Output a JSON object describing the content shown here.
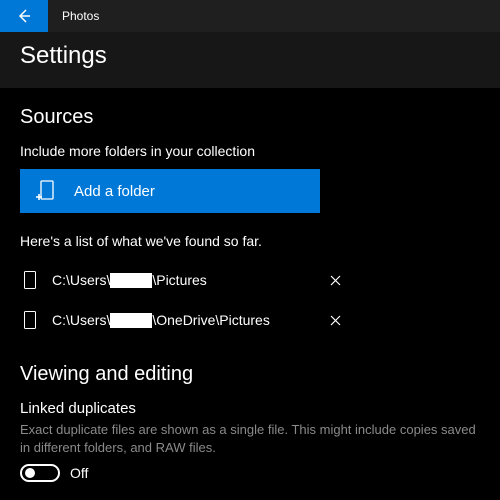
{
  "app": {
    "title": "Photos"
  },
  "page": {
    "title": "Settings"
  },
  "sources": {
    "heading": "Sources",
    "include_label": "Include more folders in your collection",
    "add_folder_label": "Add a folder",
    "found_label": "Here's a list of what we've found so far.",
    "folders": [
      {
        "prefix": "C:\\Users\\",
        "suffix": "\\Pictures"
      },
      {
        "prefix": "C:\\Users\\",
        "suffix": "\\OneDrive\\Pictures"
      }
    ]
  },
  "viewing": {
    "heading": "Viewing and editing",
    "linked_dup_title": "Linked duplicates",
    "linked_dup_desc": "Exact duplicate files are shown as a single file. This might include copies saved in different folders, and RAW files.",
    "toggle_state": "Off"
  },
  "colors": {
    "accent": "#0078d7"
  }
}
